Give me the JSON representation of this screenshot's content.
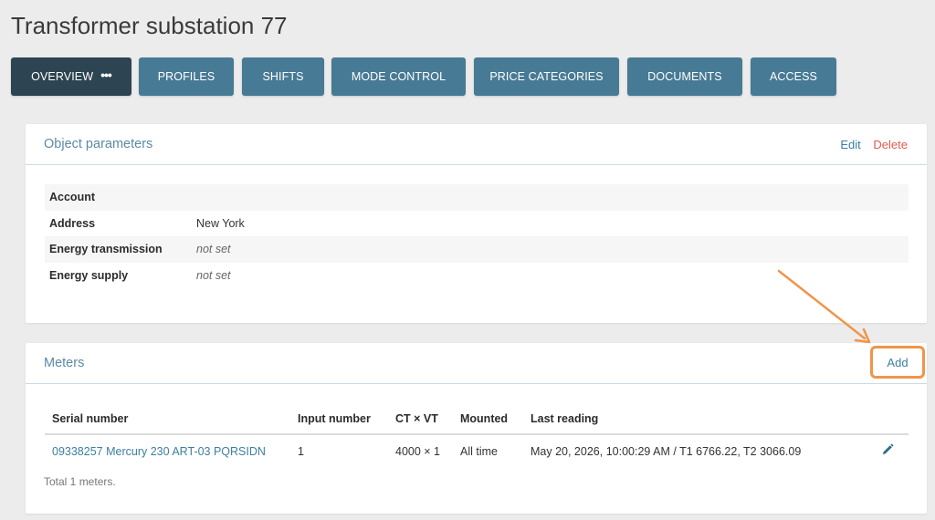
{
  "page": {
    "title": "Transformer substation 77"
  },
  "tabs": [
    {
      "label": "OVERVIEW",
      "active": true,
      "has_more": true,
      "more_glyph": "•••"
    },
    {
      "label": "PROFILES"
    },
    {
      "label": "SHIFTS"
    },
    {
      "label": "MODE CONTROL"
    },
    {
      "label": "PRICE CATEGORIES"
    },
    {
      "label": "DOCUMENTS"
    },
    {
      "label": "ACCESS"
    }
  ],
  "object_parameters": {
    "title": "Object parameters",
    "edit_label": "Edit",
    "delete_label": "Delete",
    "rows": [
      {
        "key": "Account",
        "value": "",
        "muted": false
      },
      {
        "key": "Address",
        "value": "New York",
        "muted": false
      },
      {
        "key": "Energy transmission",
        "value": "not set",
        "muted": true
      },
      {
        "key": "Energy supply",
        "value": "not set",
        "muted": true
      }
    ]
  },
  "meters": {
    "title": "Meters",
    "add_label": "Add",
    "columns": [
      "Serial number",
      "Input number",
      "CT × VT",
      "Mounted",
      "Last reading"
    ],
    "rows": [
      {
        "serial": "09338257 Mercury 230 ART-03 PQRSIDN",
        "input": "1",
        "ct_vt": "4000 × 1",
        "mounted": "All time",
        "last_reading": "May 20, 2026, 10:00:29 AM / T1 6766.22, T2 3066.09",
        "action_icon": "pencil-icon"
      }
    ],
    "total_text": "Total 1 meters."
  },
  "colors": {
    "tab": "#477a94",
    "tab_active": "#2d4452",
    "link": "#3c7fa0",
    "delete": "#e05a4f",
    "annotation": "#f0954a"
  }
}
